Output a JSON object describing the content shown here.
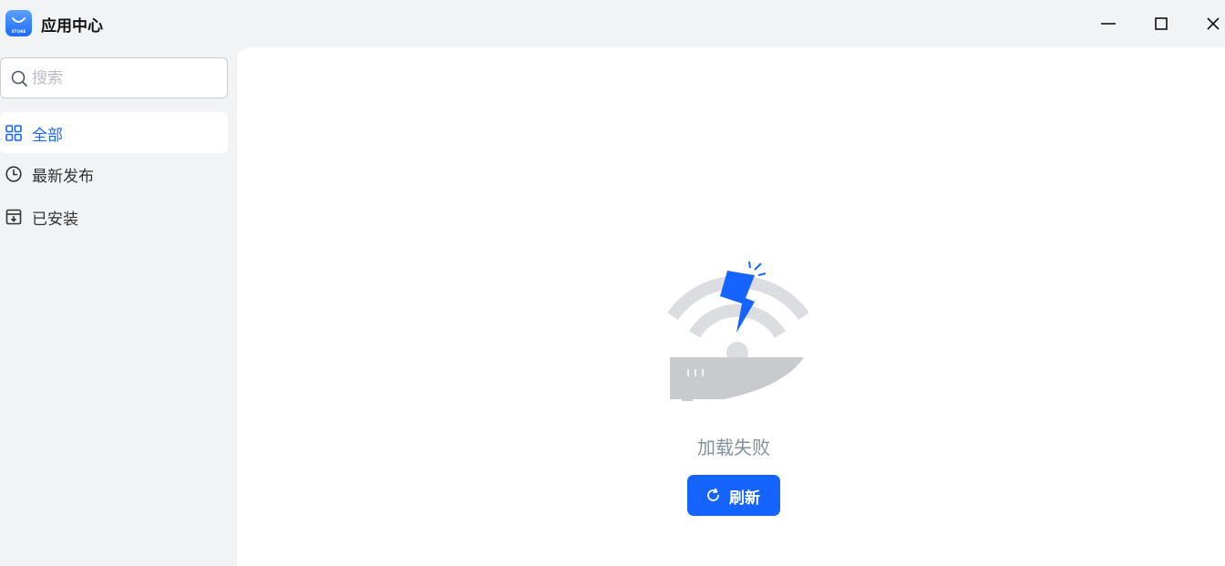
{
  "app": {
    "title": "应用中心",
    "logo_text": "STORE"
  },
  "sidebar": {
    "search": {
      "placeholder": "搜索",
      "value": ""
    },
    "items": [
      {
        "label": "全部",
        "icon": "grid-icon",
        "active": true
      },
      {
        "label": "最新发布",
        "icon": "clock-icon",
        "active": false
      },
      {
        "label": "已安装",
        "icon": "download-box-icon",
        "active": false
      }
    ]
  },
  "main": {
    "status_text": "加载失败",
    "refresh_label": "刷新",
    "illustration": "network-error-icon"
  },
  "colors": {
    "accent": "#1664ff",
    "sidebar_bg": "#f2f3f5",
    "main_bg": "#ffffff",
    "muted_text": "#86909c"
  }
}
